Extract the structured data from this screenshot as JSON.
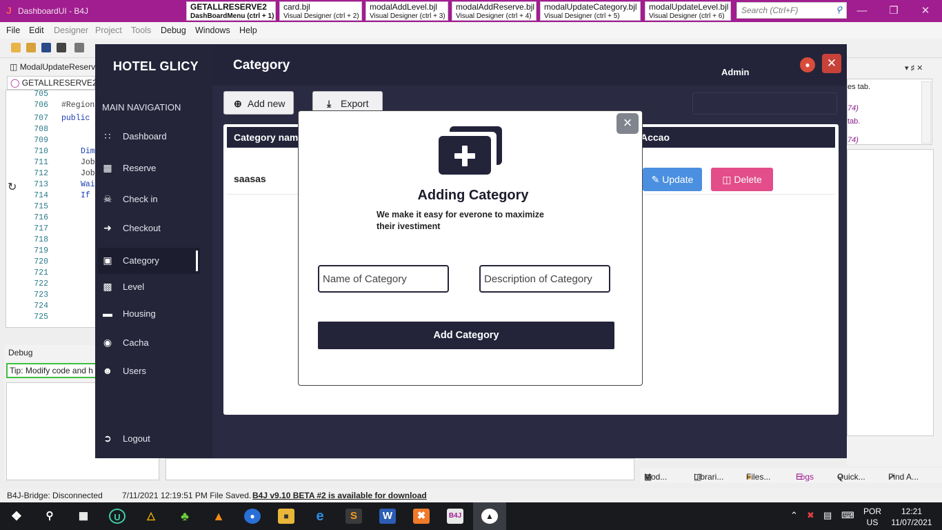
{
  "ide": {
    "title": "DashboardUI - B4J",
    "tabs": [
      {
        "name": "GETALLRESERVE2",
        "sub": "DashBoardMenu  (ctrl + 1)"
      },
      {
        "name": "card.bjl",
        "sub": "Visual Designer  (ctrl + 2)"
      },
      {
        "name": "modalAddLevel.bjl",
        "sub": "Visual Designer  (ctrl + 3)"
      },
      {
        "name": "modalAddReserve.bjl",
        "sub": "Visual Designer  (ctrl + 4)"
      },
      {
        "name": "modalUpdateCategory.bjl",
        "sub": "Visual Designer  (ctrl + 5)"
      },
      {
        "name": "modalUpdateLevel.bjl",
        "sub": "Visual Designer  (ctrl + 6)"
      }
    ],
    "search_placeholder": "Search (Ctrl+F)",
    "menu": [
      "File",
      "Edit",
      "Designer",
      "Project",
      "Tools",
      "Debug",
      "Windows",
      "Help"
    ],
    "module_tab": "ModalUpdateReserv",
    "sub_tab": "GETALLRESERVE2",
    "line_numbers": [
      "705",
      "706",
      "707",
      "708",
      "709",
      "710",
      "711",
      "712",
      "713",
      "714",
      "715",
      "716",
      "717",
      "718",
      "719",
      "720",
      "721",
      "722",
      "723",
      "724",
      "725"
    ],
    "code": {
      "l706": "#Region",
      "l707": "public",
      "l710": "Dim",
      "l711": "Job",
      "l712": "Job",
      "l713": "Wai",
      "l714": "If"
    },
    "debug_title": "Debug",
    "debug_tip": "Tip: Modify code and h",
    "right_snippets": [
      "es tab.",
      "74)",
      "tab.",
      "74)"
    ],
    "bottom_tabs": [
      "Mod...",
      "Librari...",
      "Files...",
      "Logs",
      "Quick...",
      "Find A..."
    ],
    "status": {
      "bridge": "B4J-Bridge: Disconnected",
      "saved": "7/11/2021 12:19:51 PM   File Saved.",
      "update": "B4J v9.10 BETA #2 is available for download"
    }
  },
  "taskbar": {
    "lang": "POR",
    "layout": "US",
    "time": "12:21",
    "date": "11/07/2021"
  },
  "app": {
    "brand": "HOTEL GLICY",
    "nav_heading": "MAIN NAVIGATION",
    "nav": [
      {
        "label": "Dashboard",
        "icon": "grid-icon"
      },
      {
        "label": "Reserve",
        "icon": "calendar-icon"
      },
      {
        "label": "Check in",
        "icon": "handshake-icon"
      },
      {
        "label": "Checkout",
        "icon": "sign-in-icon"
      },
      {
        "label": "Category",
        "icon": "briefcase-icon"
      },
      {
        "label": "Level",
        "icon": "building-icon"
      },
      {
        "label": "Housing",
        "icon": "bed-icon"
      },
      {
        "label": "Cacha",
        "icon": "money-icon"
      },
      {
        "label": "Users",
        "icon": "users-icon"
      }
    ],
    "logout": "Logout",
    "page_title": "Category",
    "user": "Admin",
    "buttons": {
      "add_new": "Add new",
      "export": "Export"
    },
    "table": {
      "headers": [
        "Category nam",
        "Accao"
      ],
      "rows": [
        {
          "name": "saasas",
          "update": "Update",
          "delete": "Delete"
        }
      ]
    }
  },
  "modal": {
    "title": "Adding Category",
    "subtitle": "We make it easy for everone to maximize their ivestiment",
    "name_placeholder": "Name of Category",
    "desc_placeholder": "Description of Category",
    "submit": "Add Category"
  }
}
